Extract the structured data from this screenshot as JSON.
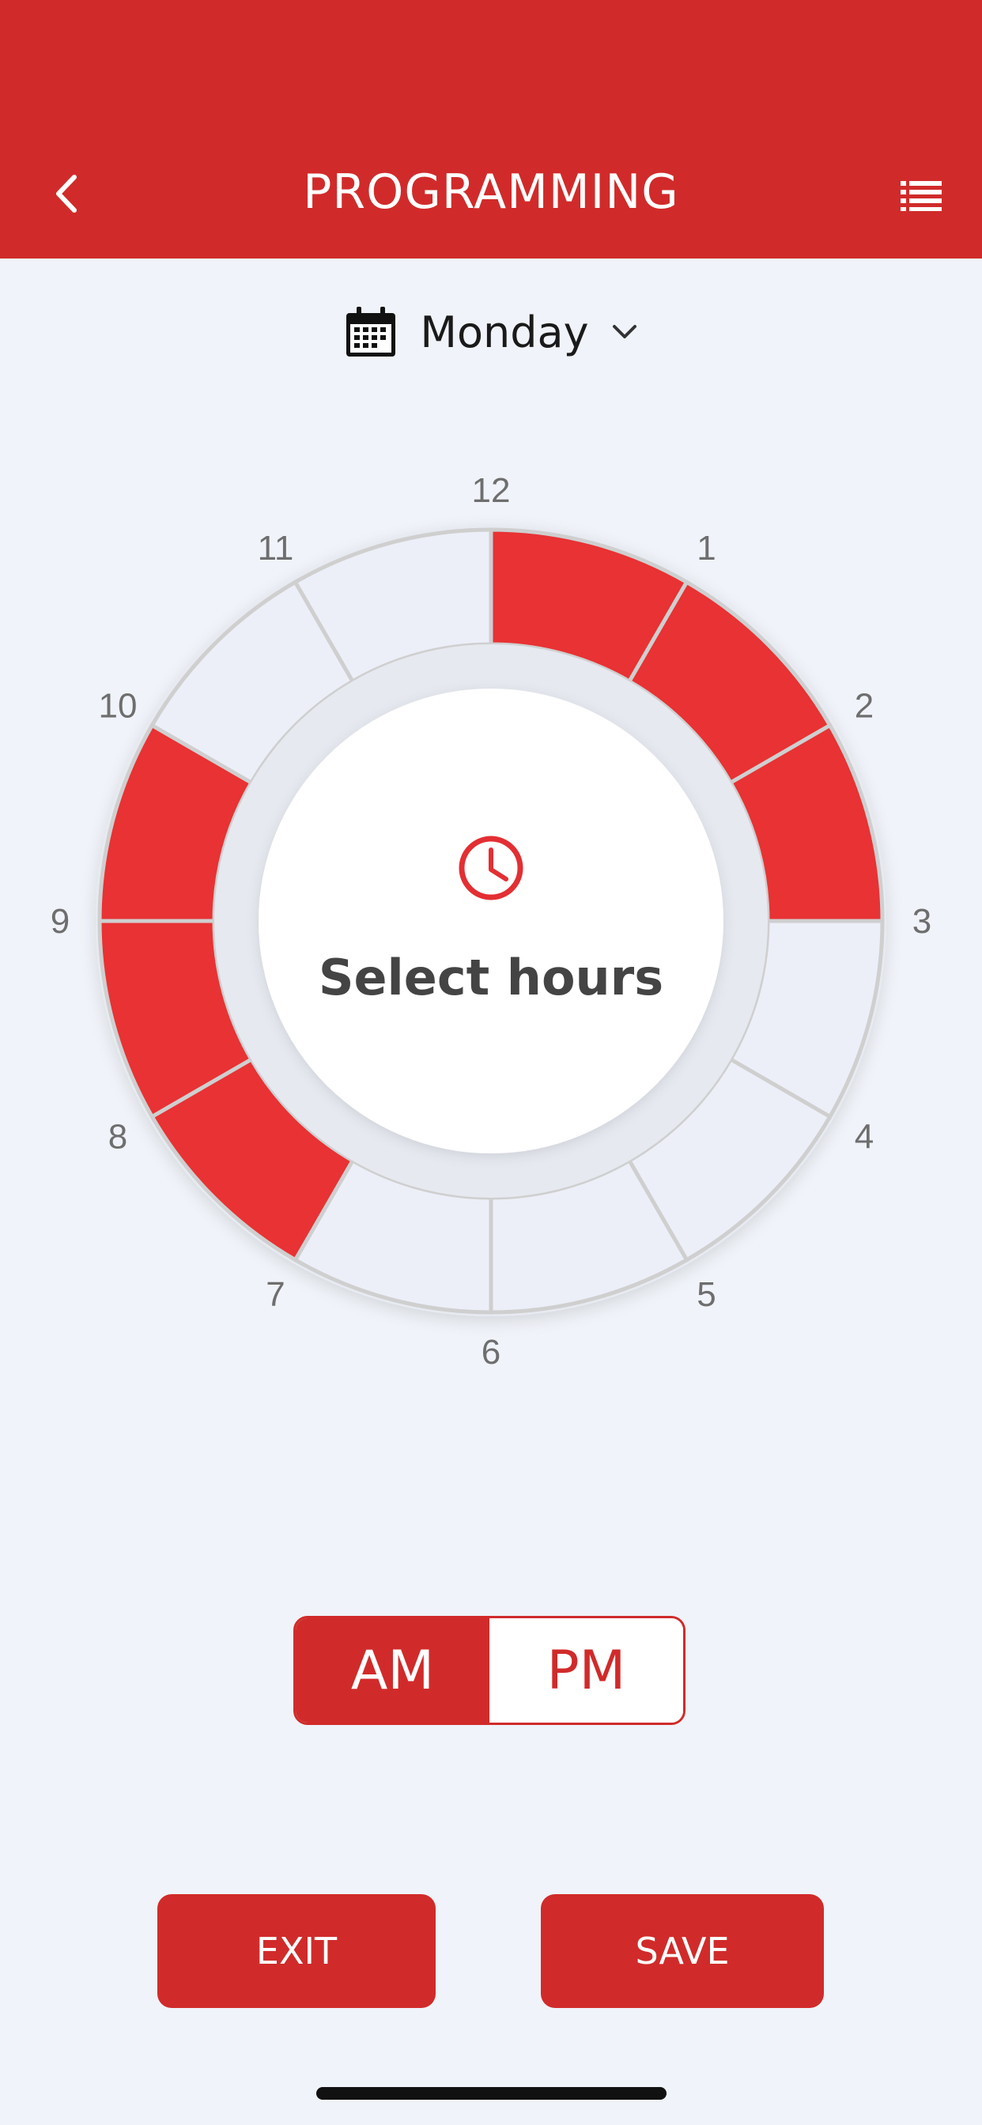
{
  "header": {
    "title": "PROGRAMMING",
    "back_icon": "chevron-left-icon",
    "menu_icon": "list-icon"
  },
  "day_selector": {
    "day": "Monday",
    "icon": "calendar-icon",
    "caret_icon": "chevron-down-icon"
  },
  "dial": {
    "center_label": "Select hours",
    "center_icon": "clock-icon",
    "hours": [
      "12",
      "1",
      "2",
      "3",
      "4",
      "5",
      "6",
      "7",
      "8",
      "9",
      "10",
      "11"
    ],
    "selected": [
      true,
      true,
      true,
      false,
      false,
      false,
      false,
      true,
      true,
      true,
      false,
      false
    ],
    "colors": {
      "selected": "#e83234",
      "unselected": "#eceff8",
      "divider": "#cfcfcf"
    }
  },
  "period_toggle": {
    "am_label": "AM",
    "pm_label": "PM",
    "active": "AM"
  },
  "actions": {
    "exit_label": "EXIT",
    "save_label": "SAVE"
  },
  "colors": {
    "brand": "#d02b2a",
    "background": "#f0f3f9"
  }
}
